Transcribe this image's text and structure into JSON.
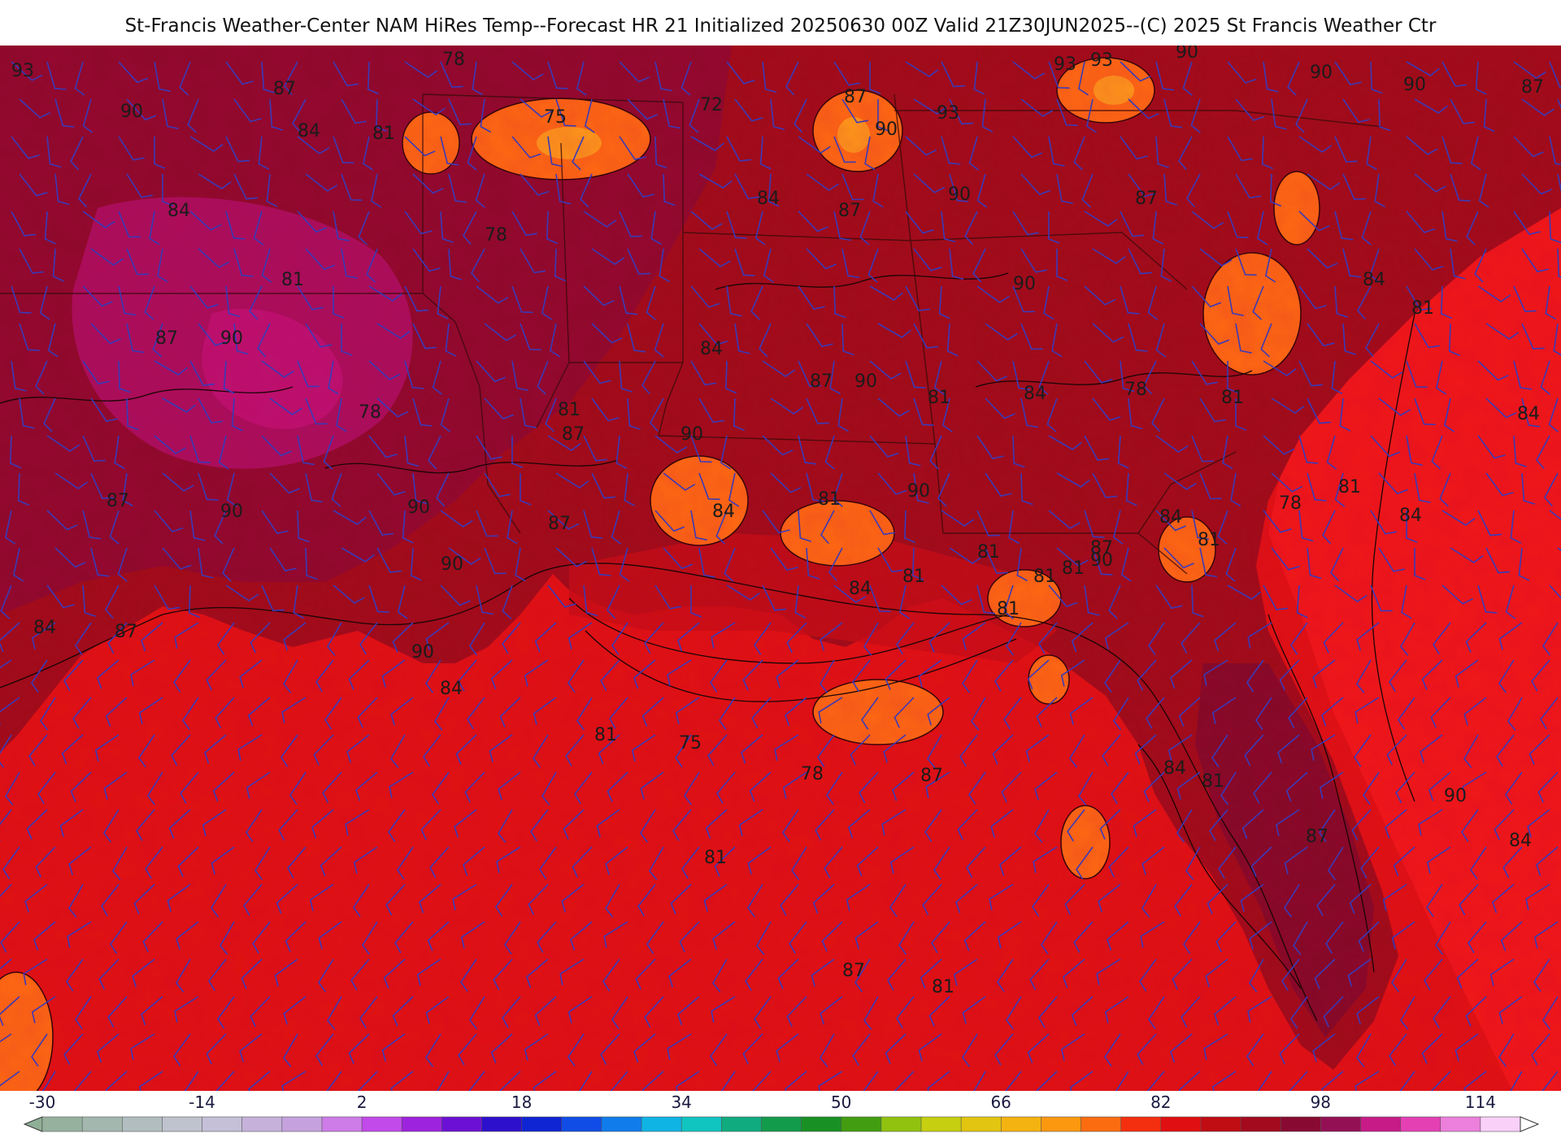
{
  "title": "St-Francis Weather-Center NAM HiRes Temp--Forecast HR 21 Initialized 20250630 00Z Valid 21Z30JUN2025--(C) 2025 St Francis Weather Ctr",
  "colorbar": {
    "ticks": [
      "-30",
      "-14",
      "2",
      "18",
      "34",
      "50",
      "66",
      "82",
      "98",
      "114"
    ],
    "range": [
      -30,
      118
    ],
    "step": 4
  },
  "contour_labels": [
    "93",
    "90",
    "87",
    "84",
    "81",
    "78",
    "75",
    "72",
    "87",
    "90",
    "93",
    "93",
    "93",
    "90",
    "90",
    "90",
    "87",
    "84",
    "81",
    "78",
    "84",
    "87",
    "90",
    "90",
    "87",
    "84",
    "81",
    "84",
    "87",
    "90",
    "78",
    "81",
    "84",
    "87",
    "90",
    "81",
    "84",
    "78",
    "81",
    "90",
    "87",
    "84",
    "81",
    "90",
    "87",
    "84",
    "81",
    "78",
    "81",
    "84",
    "87",
    "90",
    "90",
    "90",
    "87",
    "84",
    "81",
    "81",
    "81",
    "81",
    "81",
    "90",
    "84",
    "87",
    "90",
    "84",
    "81",
    "75",
    "78",
    "87",
    "84",
    "81",
    "87",
    "90",
    "84",
    "81",
    "87",
    "81"
  ],
  "colors": {
    "gulf": "#e41010",
    "land_warm": "#a80f16",
    "land_hot": "#8a0a2e",
    "hottest": "#b0106e",
    "cool_spots": "#ff7a10",
    "wind_barbs": "#3a3ab8",
    "contours": "#1a0606"
  }
}
